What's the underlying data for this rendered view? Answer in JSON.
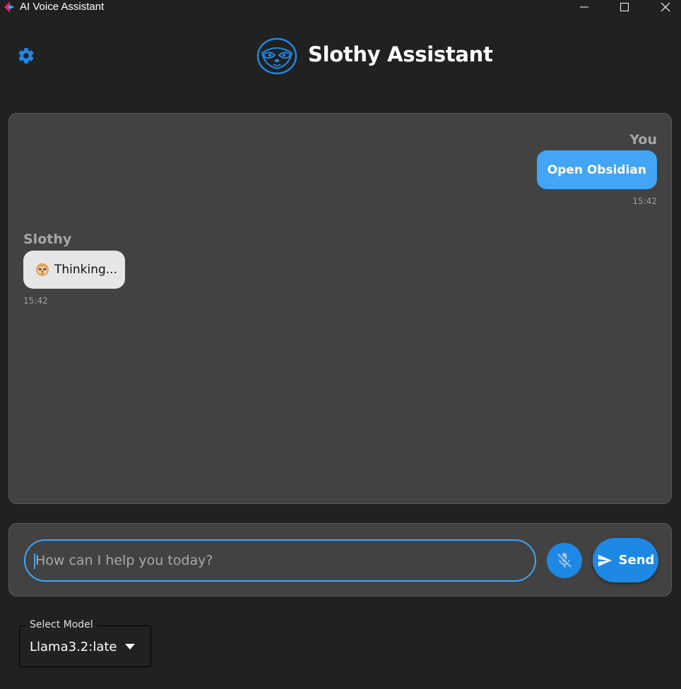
{
  "window": {
    "title": "AI Voice Assistant",
    "controls": {
      "minimize": "minimize-icon",
      "maximize": "maximize-icon",
      "close": "close-icon"
    }
  },
  "header": {
    "title": "Slothy Assistant",
    "settings_icon": "gear-icon",
    "logo_icon": "sloth-face-icon"
  },
  "chat": {
    "messages": [
      {
        "sender": "You",
        "text": "Open Obsidian",
        "time": "15:42",
        "role": "user"
      },
      {
        "sender": "Slothy",
        "text": "Thinking...",
        "time": "15:42",
        "role": "assistant",
        "icon": "sloth-emoji"
      }
    ]
  },
  "composer": {
    "placeholder": "How can I help you today?",
    "value": "",
    "mic_icon": "mic-off-icon",
    "send_label": "Send",
    "send_icon": "send-icon"
  },
  "model_selector": {
    "label": "Select Model",
    "value": "Llama3.2:late"
  },
  "colors": {
    "background": "#212121",
    "panel": "#424242",
    "accent": "#42a5f5",
    "button": "#1e88e5",
    "bot_bubble": "#e6e6e6"
  }
}
